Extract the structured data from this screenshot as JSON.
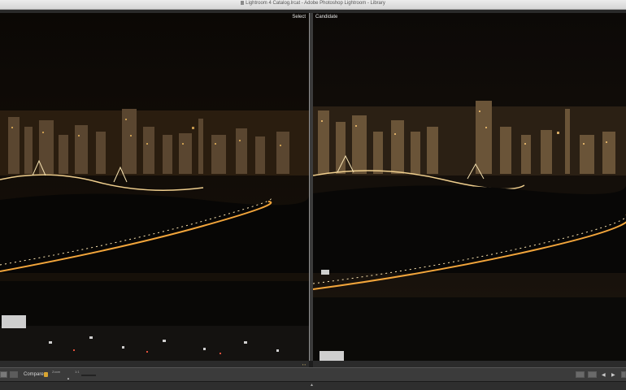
{
  "window": {
    "title": "Lightroom 4 Catalog.lrcat - Adobe Photoshop Lightroom - Library"
  },
  "compare": {
    "select_label": "Select",
    "candidate_label": "Candidate"
  },
  "toolbar": {
    "compare_label": "Compare",
    "zoom_label": "Zoom",
    "zoom_ratio": "1:1",
    "prev_arrow": "◀",
    "next_arrow": "▶"
  },
  "colors": {
    "accent_lock": "#d9a531",
    "panel_bg": "#3b3b3b",
    "photo_sky": "#0c0906"
  }
}
